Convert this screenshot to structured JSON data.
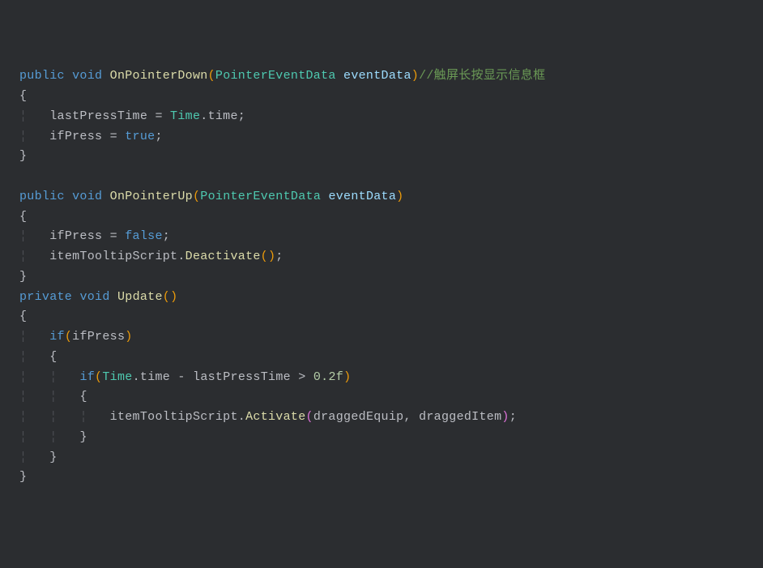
{
  "tokens": {
    "kw_public": "public",
    "kw_private": "private",
    "kw_void": "void",
    "kw_if": "if",
    "kw_true": "true",
    "kw_false": "false",
    "type_PointerEventData": "PointerEventData",
    "type_Time": "Time",
    "fn_OnPointerDown": "OnPointerDown",
    "fn_OnPointerUp": "OnPointerUp",
    "fn_Update": "Update",
    "fn_Deactivate": "Deactivate",
    "fn_Activate": "Activate",
    "param_eventData": "eventData",
    "ident_lastPressTime": "lastPressTime",
    "ident_time": "time",
    "ident_ifPress": "ifPress",
    "ident_itemTooltipScript": "itemTooltipScript",
    "ident_draggedEquip": "draggedEquip",
    "ident_draggedItem": "draggedItem",
    "num_02f": "0.2f",
    "cmt_touch": "//触屏长按显示信息框",
    "lp": "(",
    "rp": ")",
    "lp2": "(",
    "rp2": ")",
    "lb": "{",
    "rb": "}",
    "eq": " = ",
    "dot": ".",
    "semi": ";",
    "comma": ", ",
    "minus": " - ",
    "gt": " > ",
    "guide": "¦   "
  },
  "colors": {
    "background": "#2b2d30",
    "keyword": "#569cd6",
    "type": "#4ec9b0",
    "function": "#dcdcaa",
    "parameter": "#9cdcfe",
    "paren_gold": "#ec9b0a",
    "paren_purple": "#da70d6",
    "number": "#b5cea8",
    "comment": "#6a9955",
    "text": "#bcbec4",
    "indent_guide": "#4b4d52"
  },
  "source_code": "public void OnPointerDown(PointerEventData eventData)//触屏长按显示信息框\n{\n    lastPressTime = Time.time;\n    ifPress = true;\n}\n\npublic void OnPointerUp(PointerEventData eventData)\n{\n    ifPress = false;\n    itemTooltipScript.Deactivate();\n}\nprivate void Update()\n{\n    if(ifPress)\n    {\n        if(Time.time - lastPressTime > 0.2f)\n        {\n            itemTooltipScript.Activate(draggedEquip, draggedItem);\n        }\n    }\n}"
}
